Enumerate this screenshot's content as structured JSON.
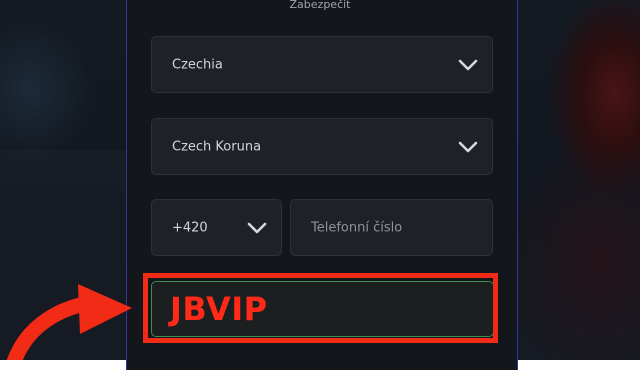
{
  "panel": {
    "title": "Zabezpečit"
  },
  "country_select": {
    "value": "Czechia",
    "icon": "chevron-down-icon"
  },
  "currency_select": {
    "value": "Czech Koruna",
    "icon": "chevron-down-icon"
  },
  "phone": {
    "code_value": "+420",
    "code_icon": "chevron-down-icon",
    "number_placeholder": "Telefonní číslo"
  },
  "promo_code": {
    "value": "JBVIP"
  },
  "colors": {
    "panel_border": "#2c3a8c",
    "field_bg": "#1f2129",
    "highlight_red": "#f22b17",
    "code_text": "#ff2a17",
    "code_border": "#3e8d4d"
  }
}
